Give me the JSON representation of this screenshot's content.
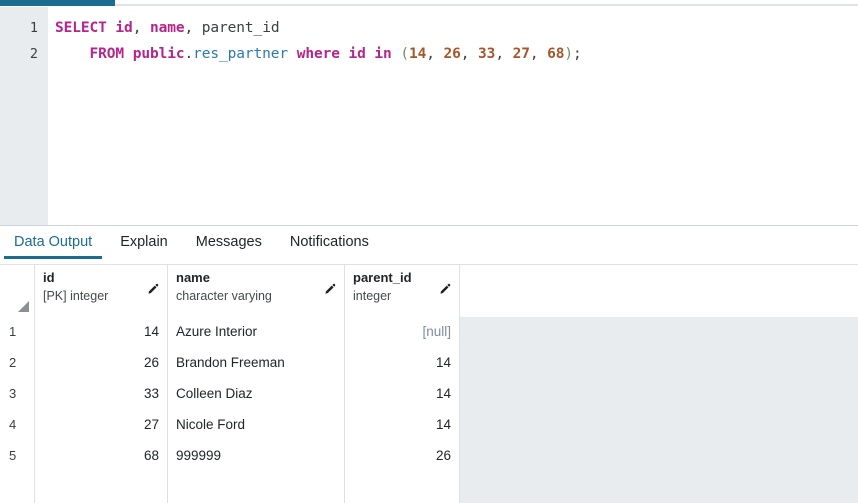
{
  "editor": {
    "lines": [
      {
        "number": "1"
      },
      {
        "number": "2"
      }
    ],
    "sql": {
      "select_kw": "SELECT",
      "col_id": "id",
      "comma1": ",",
      "col_name": "name",
      "comma2": ",",
      "col_parent": "parent_id",
      "from_kw": "FROM",
      "schema": "public",
      "dot": ".",
      "table": "res_partner",
      "where_kw": "where",
      "where_col": "id",
      "in_kw": "in",
      "paren_open": "(",
      "values": [
        "14",
        "26",
        "33",
        "27",
        "68"
      ],
      "paren_close": ")",
      "semicolon": ";",
      "full_text": "SELECT id, name, parent_id\n    FROM public.res_partner where id in (14, 26, 33, 27, 68);"
    },
    "colors": {
      "keyword": "#b5258b",
      "table": "#2a7ab0",
      "number": "#a5562c",
      "punct": "#7d8b5a",
      "plain": "#3c4043",
      "gutter_bg": "#e9ecef"
    }
  },
  "tabs": {
    "items": [
      {
        "label": "Data Output",
        "active": true
      },
      {
        "label": "Explain",
        "active": false
      },
      {
        "label": "Messages",
        "active": false
      },
      {
        "label": "Notifications",
        "active": false
      }
    ],
    "accent_color": "#1b6d8f"
  },
  "grid": {
    "corner_icon": "sort-triangle-icon",
    "columns": [
      {
        "name": "id",
        "type": "[PK] integer",
        "align": "right",
        "edit_icon": "pencil-icon"
      },
      {
        "name": "name",
        "type": "character varying",
        "align": "left",
        "edit_icon": "pencil-icon"
      },
      {
        "name": "parent_id",
        "type": "integer",
        "align": "right",
        "edit_icon": "pencil-icon"
      }
    ],
    "rows": [
      {
        "num": "1",
        "id": "14",
        "name": "Azure Interior",
        "parent_id": "[null]",
        "parent_is_null": true
      },
      {
        "num": "2",
        "id": "26",
        "name": "Brandon Freeman",
        "parent_id": "14",
        "parent_is_null": false
      },
      {
        "num": "3",
        "id": "33",
        "name": "Colleen Diaz",
        "parent_id": "14",
        "parent_is_null": false
      },
      {
        "num": "4",
        "id": "27",
        "name": "Nicole Ford",
        "parent_id": "14",
        "parent_is_null": false
      },
      {
        "num": "5",
        "id": "68",
        "name": "999999",
        "parent_id": "26",
        "parent_is_null": false
      }
    ],
    "empty_row": {
      "num": "",
      "id": "",
      "name": "",
      "parent_id": ""
    },
    "null_label": "[null]",
    "null_color": "#7d8ca0"
  }
}
